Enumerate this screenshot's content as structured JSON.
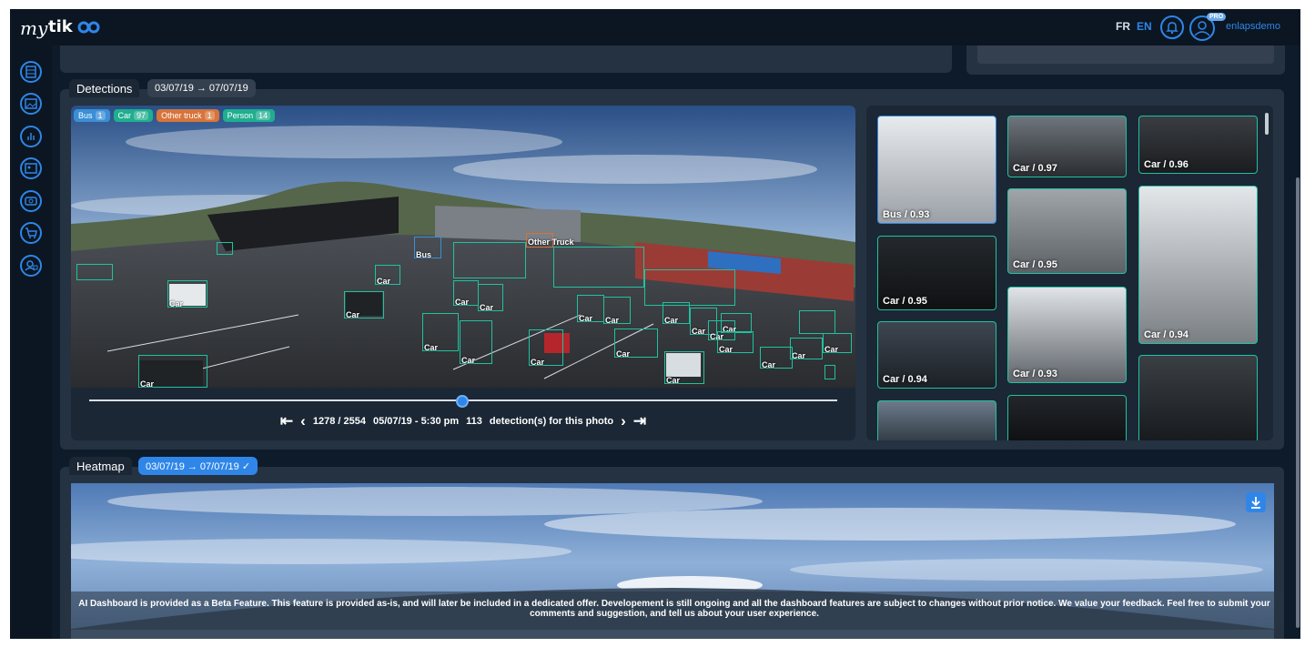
{
  "app": {
    "logo_text": "mytikee"
  },
  "header": {
    "lang_fr": "FR",
    "lang_en": "EN",
    "pro_badge": "PRO",
    "username": "enlapsdemo"
  },
  "sidebar": {
    "items": [
      {
        "icon": "film-icon"
      },
      {
        "icon": "image-gallery-icon"
      },
      {
        "icon": "bar-chart-icon"
      },
      {
        "icon": "photo-icon"
      },
      {
        "icon": "camera-icon"
      },
      {
        "icon": "cart-icon"
      },
      {
        "icon": "ai-dashboard-icon"
      }
    ]
  },
  "detections": {
    "label": "Detections",
    "date_range": "03/07/19 → 07/07/19",
    "legend": [
      {
        "name": "Bus",
        "count": "1",
        "color": "#3a8fd6"
      },
      {
        "name": "Car",
        "count": "97",
        "color": "#1fae8f"
      },
      {
        "name": "Other truck",
        "count": "1",
        "color": "#d8743a"
      },
      {
        "name": "Person",
        "count": "14",
        "color": "#1fae8f"
      }
    ],
    "boxes": [
      {
        "label": "Bus"
      },
      {
        "label": "Other Truck"
      },
      {
        "label": "Car"
      },
      {
        "label": "Car"
      },
      {
        "label": "Car"
      },
      {
        "label": "Car"
      },
      {
        "label": "Car"
      },
      {
        "label": "Car"
      },
      {
        "label": "Car"
      },
      {
        "label": "Car"
      },
      {
        "label": "Car"
      },
      {
        "label": "Car"
      },
      {
        "label": "Car"
      },
      {
        "label": "Car"
      },
      {
        "label": "Car"
      },
      {
        "label": "Car"
      },
      {
        "label": "Car"
      },
      {
        "label": "Car"
      },
      {
        "label": "Car"
      },
      {
        "label": "Car"
      },
      {
        "label": "Car"
      },
      {
        "label": "Car"
      },
      {
        "label": "Car"
      }
    ],
    "slider_position": 0.5,
    "frame_counter": "1278 / 2554",
    "timestamp": "05/07/19 - 5:30 pm",
    "detection_count": "113",
    "detection_text": "detection(s) for this photo",
    "thumbnails": [
      {
        "label": "Bus / 0.93",
        "selected": true
      },
      {
        "label": "Car / 0.97"
      },
      {
        "label": "Car / 0.96"
      },
      {
        "label": "Car / 0.95"
      },
      {
        "label": "Car / 0.95"
      },
      {
        "label": "Car / 0.94"
      },
      {
        "label": "Car / 0.94"
      },
      {
        "label": "Car / 0.93"
      },
      {
        "label": ""
      },
      {
        "label": ""
      },
      {
        "label": ""
      }
    ]
  },
  "heatmap": {
    "label": "Heatmap",
    "date_range": "03/07/19 → 07/07/19"
  },
  "beta_notice": "AI Dashboard is provided as a Beta Feature. This feature is provided as-is, and will later be included in a dedicated offer. Developement is still ongoing and all the dashboard features are subject to changes without prior notice. We value your feedback. Feel free to submit your comments and suggestion, and tell us about your user experience."
}
